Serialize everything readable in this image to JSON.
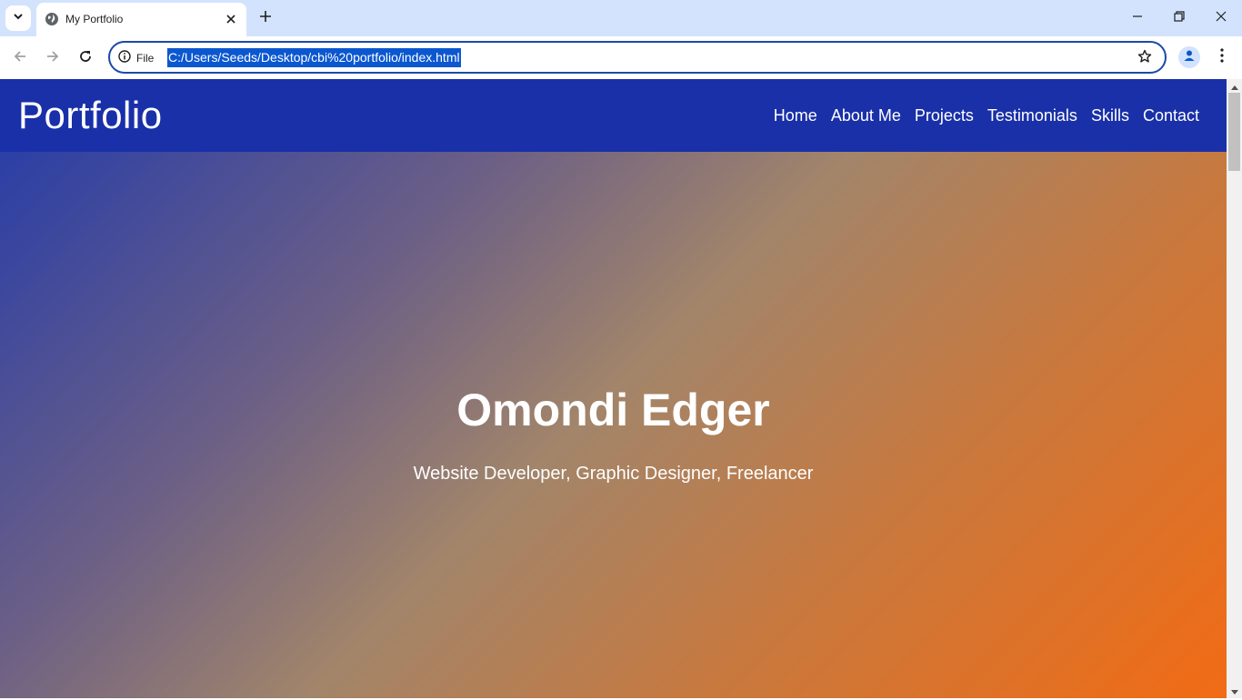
{
  "browser": {
    "tab_title": "My Portfolio",
    "omnibox": {
      "site_info_label": "File",
      "url": "C:/Users/Seeds/Desktop/cbi%20portfolio/index.html"
    },
    "icons": {
      "tab_search": "chevron-down-icon",
      "favicon": "globe-icon",
      "tab_close": "close-icon",
      "new_tab": "plus-icon",
      "minimize": "minimize-icon",
      "restore": "restore-icon",
      "close_window": "close-icon",
      "back": "arrow-left-icon",
      "forward": "arrow-right-icon",
      "reload": "reload-icon",
      "info": "info-icon",
      "bookmark": "star-icon",
      "profile": "person-icon",
      "menu": "kebab-menu-icon"
    }
  },
  "site": {
    "logo": "Portfolio",
    "nav": [
      "Home",
      "About Me",
      "Projects",
      "Testimonials",
      "Skills",
      "Contact"
    ],
    "hero": {
      "name": "Omondi Edger",
      "subtitle": "Website Developer, Graphic Designer, Freelancer"
    },
    "colors": {
      "header_bg": "#1a30a8",
      "gradient_start": "#2b3fa6",
      "gradient_end": "#f26b14"
    }
  }
}
